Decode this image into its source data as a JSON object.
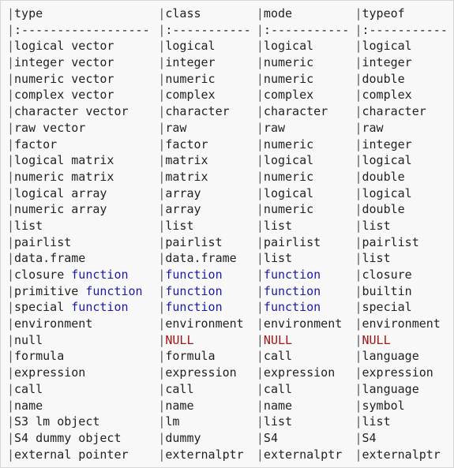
{
  "pipe": "|",
  "separator": ":------------------",
  "colors": {
    "background": "#f8f8f8",
    "text": "#222222",
    "keyword_function": "#1a1aa6",
    "keyword_null": "#a31515"
  },
  "rows": [
    [
      "type",
      "class",
      "mode",
      "typeof"
    ],
    [
      ":------------------",
      ":-----------",
      ":-----------",
      ":-----------"
    ],
    [
      "logical vector",
      "logical",
      "logical",
      "logical"
    ],
    [
      "integer vector",
      "integer",
      "numeric",
      "integer"
    ],
    [
      "numeric vector",
      "numeric",
      "numeric",
      "double"
    ],
    [
      "complex vector",
      "complex",
      "complex",
      "complex"
    ],
    [
      "character vector",
      "character",
      "character",
      "character"
    ],
    [
      "raw vector",
      "raw",
      "raw",
      "raw"
    ],
    [
      "factor",
      "factor",
      "numeric",
      "integer"
    ],
    [
      "logical matrix",
      "matrix",
      "logical",
      "logical"
    ],
    [
      "numeric matrix",
      "matrix",
      "numeric",
      "double"
    ],
    [
      "logical array",
      "array",
      "logical",
      "logical"
    ],
    [
      "numeric array",
      "array",
      "numeric",
      "double"
    ],
    [
      "list",
      "list",
      "list",
      "list"
    ],
    [
      "pairlist",
      "pairlist",
      "pairlist",
      "pairlist"
    ],
    [
      "data.frame",
      "data.frame",
      "list",
      "list"
    ],
    [
      "closure function",
      "function",
      "function",
      "closure"
    ],
    [
      "primitive function",
      "function",
      "function",
      "builtin"
    ],
    [
      "special function",
      "function",
      "function",
      "special"
    ],
    [
      "environment",
      "environment",
      "environment",
      "environment"
    ],
    [
      "null",
      "NULL",
      "NULL",
      "NULL"
    ],
    [
      "formula",
      "formula",
      "call",
      "language"
    ],
    [
      "expression",
      "expression",
      "expression",
      "expression"
    ],
    [
      "call",
      "call",
      "call",
      "language"
    ],
    [
      "name",
      "name",
      "name",
      "symbol"
    ],
    [
      "S3 lm object",
      "lm",
      "list",
      "list"
    ],
    [
      "S4 dummy object",
      "dummy",
      "S4",
      "S4"
    ],
    [
      "external pointer",
      "externalptr",
      "externalptr",
      "externalptr"
    ]
  ]
}
